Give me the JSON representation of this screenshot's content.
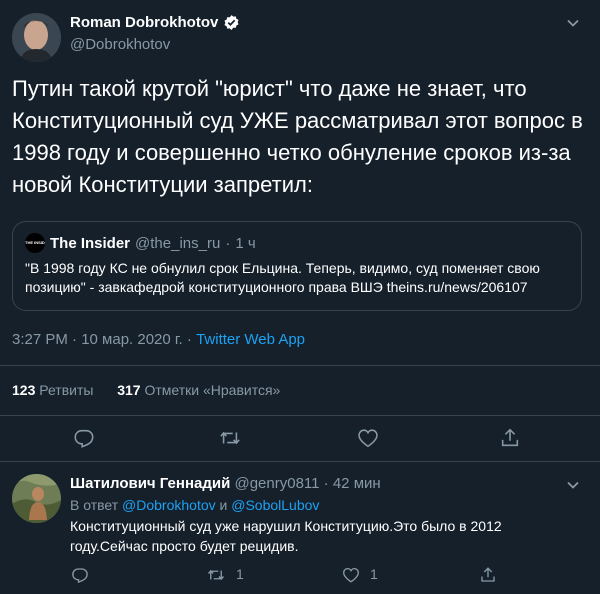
{
  "tweet": {
    "author_name": "Roman Dobrokhotov",
    "author_handle": "@Dobrokhotov",
    "text": "Путин такой крутой \"юрист\" что даже не знает, что Конституционный суд УЖЕ рассматривал этот вопрос в 1998 году и совершенно четко обнуление сроков из-за новой Конституции запретил:",
    "quoted": {
      "logo_text": "THE INSIDER",
      "name": "The Insider",
      "handle": "@the_ins_ru",
      "separator": "·",
      "time": "1 ч",
      "text_line1": "\"В 1998 году КС не обнулил срок Ельцина. Теперь, видимо, суд поменяет свою",
      "text_line2": "позицию\" - завкафедрой конституционного права ВШЭ theins.ru/news/206107"
    },
    "timestamp": "3:27 PM · 10 мар. 2020 г. ·",
    "source": "Twitter Web App",
    "retweets_count": "123",
    "retweets_label": "Ретвиты",
    "likes_count": "317",
    "likes_label": "Отметки «Нравится»"
  },
  "reply": {
    "author_name": "Шатилович Геннадий",
    "author_handle": "@genry0811",
    "separator": "·",
    "time": "42 мин",
    "reply_prefix": "В ответ",
    "reply_to_1": "@Dobrokhotov",
    "reply_and": "и",
    "reply_to_2": "@SobolLubov",
    "text_line1": "Конституционный суд уже нарушил Конституцию.Это было в 2012",
    "text_line2": "году.Сейчас просто будет рецидив.",
    "retweet_count": "1",
    "like_count": "1"
  },
  "icons": [
    "verified-icon",
    "chevron-down-icon",
    "reply-icon",
    "retweet-icon",
    "like-icon",
    "share-icon"
  ],
  "colors": {
    "background": "#15202b",
    "text": "#ffffff",
    "muted": "#8899a6",
    "accent": "#1da1f2",
    "border": "#38444d"
  }
}
